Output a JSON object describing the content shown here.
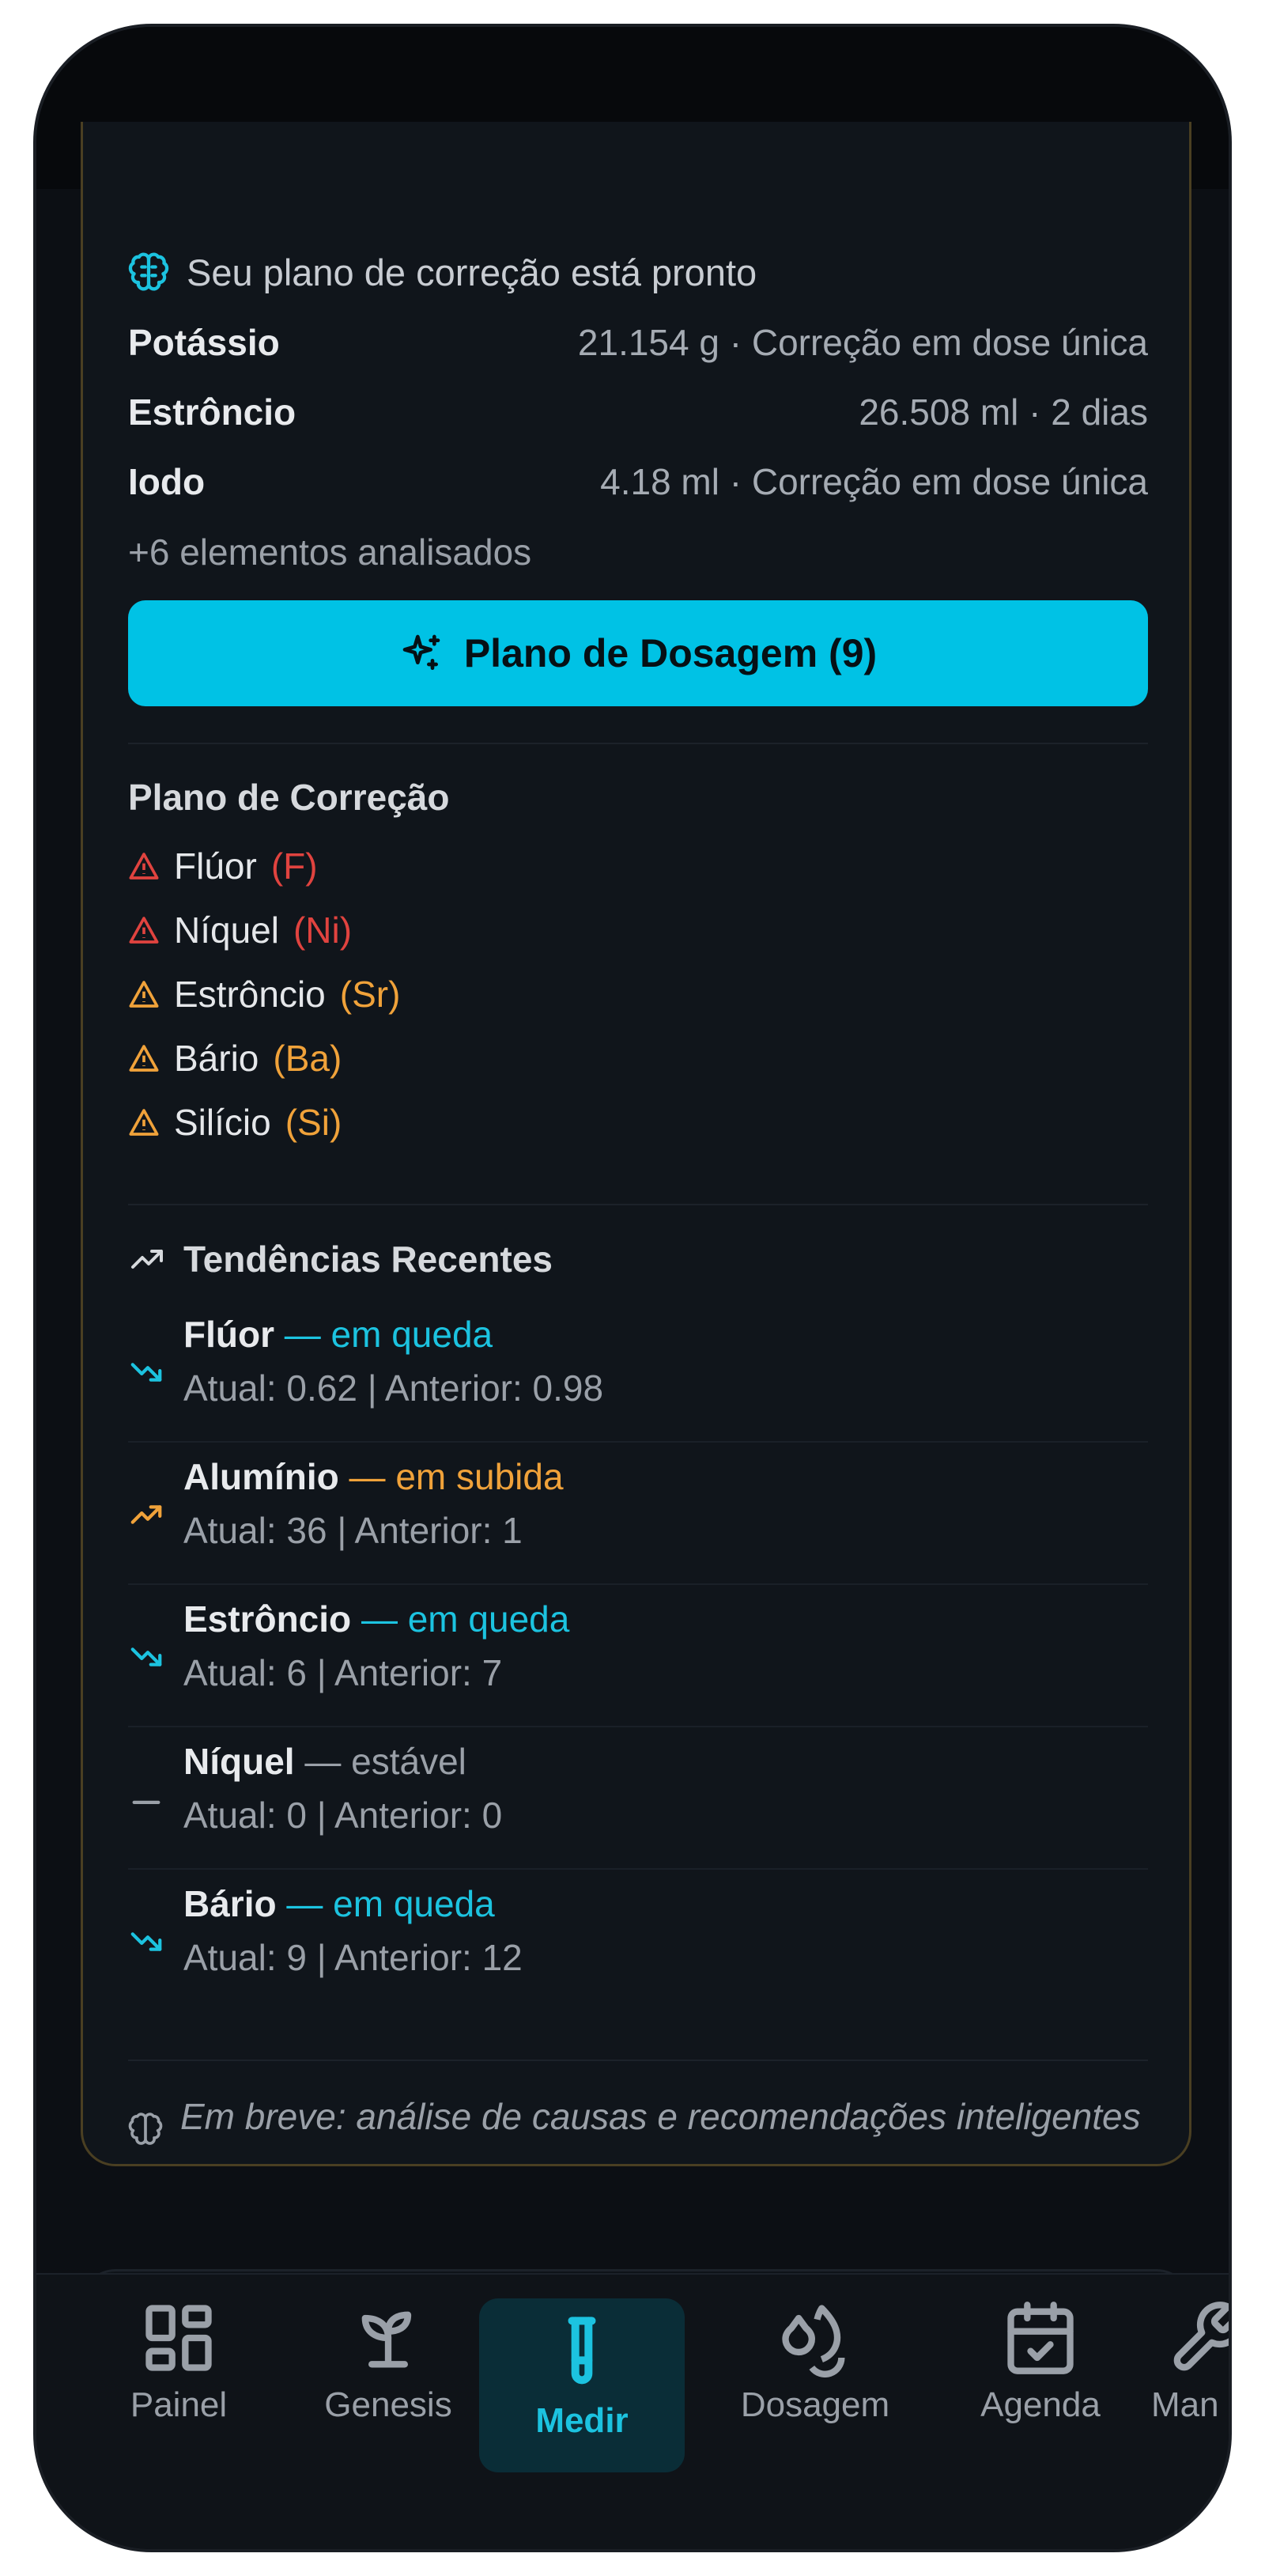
{
  "plan_header": "Seu plano de correção está pronto",
  "summary": [
    {
      "label": "Potássio",
      "value": "21.154 g · Correção em dose única"
    },
    {
      "label": "Estrôncio",
      "value": "26.508 ml · 2 dias"
    },
    {
      "label": "Iodo",
      "value": "4.18 ml · Correção em dose única"
    }
  ],
  "more_elements": "+6 elementos analisados",
  "dosage_button": "Plano de Dosagem (9)",
  "correction": {
    "title": "Plano de Correção",
    "items": [
      {
        "name": "Flúor",
        "symbol": "(F)",
        "color": "#e0433f"
      },
      {
        "name": "Níquel",
        "symbol": "(Ni)",
        "color": "#e0433f"
      },
      {
        "name": "Estrôncio",
        "symbol": "(Sr)",
        "color": "#f0a23a"
      },
      {
        "name": "Bário",
        "symbol": "(Ba)",
        "color": "#f0a23a"
      },
      {
        "name": "Silício",
        "symbol": "(Si)",
        "color": "#f0a23a"
      }
    ]
  },
  "trends": {
    "title": "Tendências Recentes",
    "items": [
      {
        "name": "Flúor",
        "status": "— em queda",
        "values": "Atual: 0.62 | Anterior: 0.98"
      },
      {
        "name": "Alumínio",
        "status": "— em subida",
        "values": "Atual: 36 | Anterior: 1"
      },
      {
        "name": "Estrôncio",
        "status": "— em queda",
        "values": "Atual: 6 | Anterior: 7"
      },
      {
        "name": "Níquel",
        "status": "— estável",
        "values": "Atual: 0 | Anterior: 0"
      },
      {
        "name": "Bário",
        "status": "— em queda",
        "values": "Atual: 9 | Anterior: 12"
      }
    ]
  },
  "coming_soon": "Em breve: análise de causas e recomendações inteligentes",
  "nav": [
    "Painel",
    "Genesis",
    "Medir",
    "Dosagem",
    "Agenda",
    "Man"
  ],
  "colors": {
    "accent": "#00c2e5",
    "danger": "#e0433f",
    "warning": "#f0a23a",
    "trend_down": "#1cc3e0"
  }
}
